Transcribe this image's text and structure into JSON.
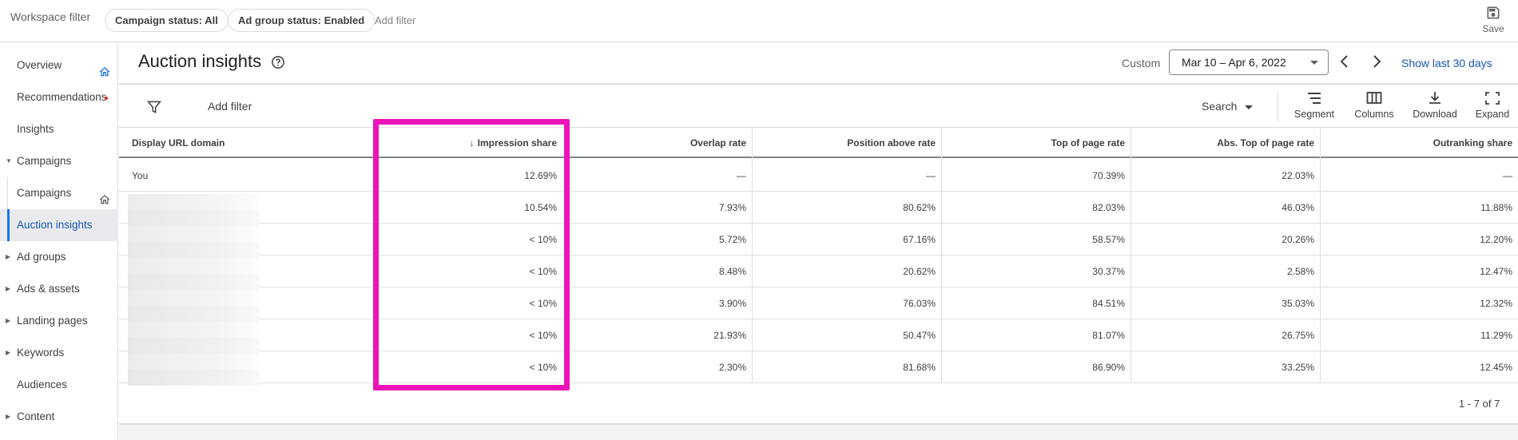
{
  "topbar": {
    "workspace_filter": "Workspace filter",
    "chips": [
      "Campaign status: All",
      "Ad group status: Enabled"
    ],
    "add_filter": "Add filter",
    "save_label": "Save"
  },
  "sidebar": {
    "items": [
      {
        "label": "Overview"
      },
      {
        "label": "Recommendations"
      },
      {
        "label": "Insights"
      },
      {
        "label": "Campaigns"
      },
      {
        "label": "Campaigns"
      },
      {
        "label": "Auction insights"
      },
      {
        "label": "Ad groups"
      },
      {
        "label": "Ads & assets"
      },
      {
        "label": "Landing pages"
      },
      {
        "label": "Keywords"
      },
      {
        "label": "Audiences"
      },
      {
        "label": "Content"
      }
    ]
  },
  "header": {
    "title": "Auction insights",
    "custom_label": "Custom",
    "date_range": "Mar 10 – Apr 6, 2022",
    "show_last": "Show last 30 days"
  },
  "toolbar": {
    "add_filter": "Add filter",
    "search": "Search",
    "tools": [
      "Segment",
      "Columns",
      "Download",
      "Expand"
    ]
  },
  "table": {
    "columns": [
      "Display URL domain",
      "Impression share",
      "Overlap rate",
      "Position above rate",
      "Top of page rate",
      "Abs. Top of page rate",
      "Outranking share"
    ],
    "rows": [
      [
        "You",
        "12.69%",
        "—",
        "—",
        "70.39%",
        "22.03%",
        "—"
      ],
      [
        "",
        "10.54%",
        "7.93%",
        "80.62%",
        "82.03%",
        "46.03%",
        "11.88%"
      ],
      [
        "",
        "< 10%",
        "5.72%",
        "67.16%",
        "58.57%",
        "20.26%",
        "12.20%"
      ],
      [
        "",
        "< 10%",
        "8.48%",
        "20.62%",
        "30.37%",
        "2.58%",
        "12.47%"
      ],
      [
        "",
        "< 10%",
        "3.90%",
        "76.03%",
        "84.51%",
        "35.03%",
        "12.32%"
      ],
      [
        "",
        "< 10%",
        "21.93%",
        "50.47%",
        "81.07%",
        "26.75%",
        "11.29%"
      ],
      [
        "",
        "< 10%",
        "2.30%",
        "81.68%",
        "86.90%",
        "33.25%",
        "12.45%"
      ]
    ],
    "pagination": "1 - 7 of 7"
  },
  "colors": {
    "accent": "#1a73e8",
    "link": "#1a56ad",
    "highlight": "#ec13b8"
  }
}
